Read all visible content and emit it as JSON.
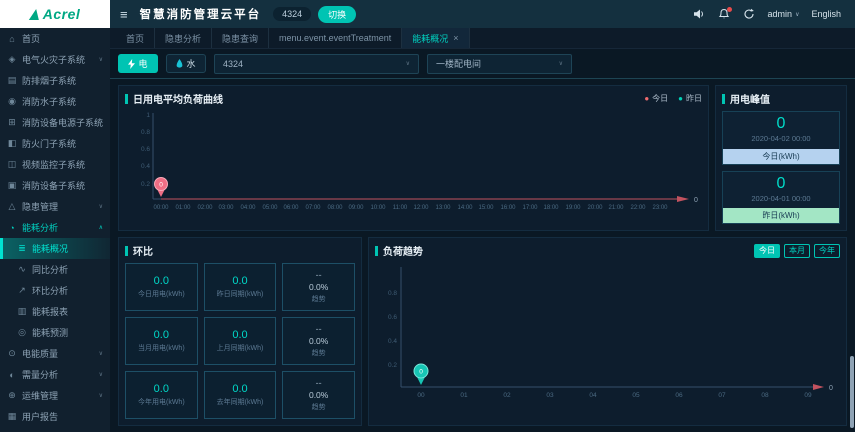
{
  "colors": {
    "accent": "#00c4b3",
    "today_series": "#ee6b6e",
    "yesterday_series": "#00d0b6",
    "today_bar": "#b5d2ef",
    "yesterday_bar": "#a3e6c5",
    "alert_dot": "#e84b4b"
  },
  "icons": {
    "hamburger": "≡",
    "chevron_down": "∨",
    "chevron_up": "∧",
    "close": "×",
    "select_caret": "∨",
    "legend_dot": "●",
    "user_caret": "∨"
  },
  "header": {
    "logo_text": "Acrel",
    "title": "智慧消防管理云平台",
    "badge": "4324",
    "switch_label": "切换",
    "user": "admin",
    "language": "English"
  },
  "tabs": [
    {
      "label": "首页"
    },
    {
      "label": "隐患分析"
    },
    {
      "label": "隐患查询"
    },
    {
      "label": "menu.event.eventTreatment"
    },
    {
      "label": "能耗概况",
      "active": true,
      "closable": true
    }
  ],
  "toolbar": {
    "electric_label": "电",
    "water_label": "水",
    "device_value": "4324",
    "room_value": "一楼配电间"
  },
  "sidebar": {
    "items": [
      {
        "label": "首页",
        "glyph": "⌂"
      },
      {
        "label": "电气火灾子系统",
        "glyph": "◈",
        "expandable": true
      },
      {
        "label": "防排烟子系统",
        "glyph": "▤"
      },
      {
        "label": "消防水子系统",
        "glyph": "◉"
      },
      {
        "label": "消防设备电源子系统",
        "glyph": "⊞"
      },
      {
        "label": "防火门子系统",
        "glyph": "◧"
      },
      {
        "label": "视频监控子系统",
        "glyph": "◫"
      },
      {
        "label": "消防设备子系统",
        "glyph": "▣"
      },
      {
        "label": "隐患管理",
        "glyph": "△",
        "expandable": true
      },
      {
        "label": "能耗分析",
        "glyph": "◔",
        "expandable": true,
        "expanded": true,
        "children": [
          {
            "label": "能耗概况",
            "glyph": "≣",
            "active": true
          },
          {
            "label": "同比分析",
            "glyph": "∿"
          },
          {
            "label": "环比分析",
            "glyph": "↗"
          },
          {
            "label": "能耗报表",
            "glyph": "▥"
          },
          {
            "label": "能耗预测",
            "glyph": "◎"
          }
        ]
      },
      {
        "label": "电能质量",
        "glyph": "⊙",
        "expandable": true
      },
      {
        "label": "需量分析",
        "glyph": "◐",
        "expandable": true
      },
      {
        "label": "运维管理",
        "glyph": "⊕",
        "expandable": true
      },
      {
        "label": "用户报告",
        "glyph": "▦"
      }
    ]
  },
  "panels": {
    "peak": {
      "title": "用电峰值",
      "cards": [
        {
          "value": "0",
          "time": "2020-04-02 00:00",
          "label": "今日(kWh)"
        },
        {
          "value": "0",
          "time": "2020-04-01 00:00",
          "label": "昨日(kWh)"
        }
      ]
    },
    "ratio": {
      "title": "环比",
      "cells": [
        {
          "type": "value",
          "value": "0.0",
          "label": "今日用电(kWh)"
        },
        {
          "type": "value",
          "value": "0.0",
          "label": "昨日同期(kWh)"
        },
        {
          "type": "trend",
          "dash": "--",
          "value": "0.0%",
          "label": "趋势"
        },
        {
          "type": "value",
          "value": "0.0",
          "label": "当月用电(kWh)"
        },
        {
          "type": "value",
          "value": "0.0",
          "label": "上月同期(kWh)"
        },
        {
          "type": "trend",
          "dash": "--",
          "value": "0.0%",
          "label": "趋势"
        },
        {
          "type": "value",
          "value": "0.0",
          "label": "今年用电(kWh)"
        },
        {
          "type": "value",
          "value": "0.0",
          "label": "去年同期(kWh)"
        },
        {
          "type": "trend",
          "dash": "--",
          "value": "0.0%",
          "label": "趋势"
        }
      ]
    },
    "trend": {
      "buttons": [
        {
          "label": "今日",
          "active": true
        },
        {
          "label": "本月"
        },
        {
          "label": "今年"
        }
      ]
    }
  },
  "chart_data": [
    {
      "type": "line",
      "title": "日用电平均负荷曲线",
      "x": [
        "00:00",
        "01:00",
        "02:00",
        "03:00",
        "04:00",
        "05:00",
        "06:00",
        "07:00",
        "08:00",
        "09:00",
        "10:00",
        "11:00",
        "12:00",
        "13:00",
        "14:00",
        "15:00",
        "16:00",
        "17:00",
        "18:00",
        "19:00",
        "20:00",
        "21:00",
        "22:00",
        "23:00"
      ],
      "series": [
        {
          "name": "今日",
          "color": "#ee6b6e",
          "values": [
            0
          ]
        },
        {
          "name": "昨日",
          "color": "#00d0b6",
          "values": [
            0,
            0,
            0,
            0,
            0,
            0,
            0,
            0,
            0,
            0,
            0,
            0,
            0,
            0,
            0,
            0,
            0,
            0,
            0,
            0,
            0,
            0,
            0,
            0
          ]
        }
      ],
      "ylim": [
        0,
        1
      ],
      "y_ticks": [
        "0.2",
        "0.4",
        "0.6",
        "0.8",
        "1"
      ],
      "legend_position": "top-right",
      "grid": false,
      "marker": {
        "x": "00:00",
        "value": "0",
        "color": "#f0708c"
      },
      "end_label": "0"
    },
    {
      "type": "line",
      "title": "负荷趋势",
      "x": [
        "00",
        "01",
        "02",
        "03",
        "04",
        "05",
        "06",
        "07",
        "08",
        "09"
      ],
      "series": [
        {
          "name": "今日",
          "color": "#17c5b4",
          "values": [
            0
          ]
        }
      ],
      "ylim": [
        0,
        1
      ],
      "y_ticks": [
        "0.2",
        "0.4",
        "0.6",
        "0.8"
      ],
      "grid": false,
      "marker": {
        "x": "00",
        "value": "0",
        "color": "#17c5b4"
      },
      "end_label": "0"
    }
  ]
}
